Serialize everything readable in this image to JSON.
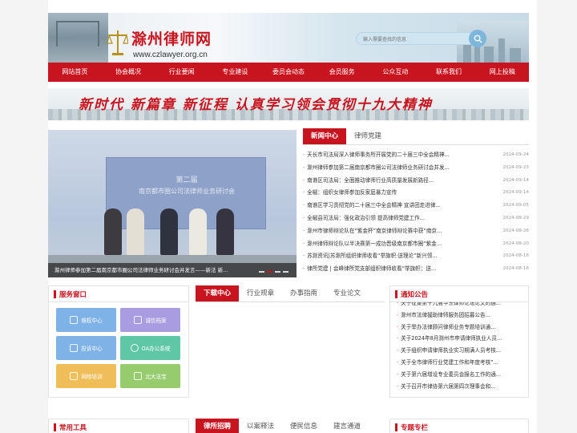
{
  "site": {
    "title": "滁州律师网",
    "url": "www.czlawyer.org.cn"
  },
  "search": {
    "placeholder": "输入需要查找的信息",
    "icon": "search-icon"
  },
  "nav": [
    {
      "label": "网站首页"
    },
    {
      "label": "协会概况"
    },
    {
      "label": "行业要闻"
    },
    {
      "label": "专业建设"
    },
    {
      "label": "委员会动态"
    },
    {
      "label": "会员服务"
    },
    {
      "label": "公众互动"
    },
    {
      "label": "联系我们"
    },
    {
      "label": "网上投稿"
    }
  ],
  "banner": {
    "text": "新时代 新篇章 新征程 认真学习领会贯彻十九大精神"
  },
  "slideshow": {
    "caption": "滁州律师参加第二届南京都市圈公司法律师业务研讨会并发言——新法 新...",
    "board_text": "第二届",
    "board_text2": "南京都市圈公司法律师业务研讨会",
    "active_dot": 1
  },
  "news": {
    "tabs": [
      {
        "label": "新闻中心"
      },
      {
        "label": "律师党建"
      }
    ],
    "items": [
      {
        "title": "天长市司法局深入律师事务所开展党的二十届三中全会精神...",
        "date": "2024-09-24"
      },
      {
        "title": "滁州律师参加第二届南京都市圈公司法律师业务研讨会并发...",
        "date": "2024-09-23"
      },
      {
        "title": "南谯区司法局：全面推动律师行业高质量发展新路径...",
        "date": "2024-09-14"
      },
      {
        "title": "全椒：组织女律师参加反家庭暴力宣传",
        "date": "2024-09-14"
      },
      {
        "title": "南谯区学习贯彻党的二十届三中全会精神 宣讲团走进律...",
        "date": "2024-09-05"
      },
      {
        "title": "全椒县司法局：强化政治引领 提高律师党建工作...",
        "date": "2024-08-29"
      },
      {
        "title": "滁州市律师辩论队在“紫金杯”南京律师辩论赛中获“南京...",
        "date": "2024-08-26"
      },
      {
        "title": "滁州律师辩论队以半决赛第一成功晋级南京都市圈“紫金...",
        "date": "2024-08-20"
      },
      {
        "title": "苏滁资讯|苏滁所组织律师收看“举旗帜·送理论”新兴领...",
        "date": "2024-08-16"
      },
      {
        "title": "律所党建 | 会峰律所党支部组织律师收看“举旗帜：送...",
        "date": "2024-08-16"
      }
    ]
  },
  "service": {
    "title": "服务窗口",
    "items": [
      {
        "label": "维权中心",
        "icon": "shield-icon",
        "color": "#7fb2e6"
      },
      {
        "label": "诚信档案",
        "icon": "file-icon",
        "color": "#a99ce0"
      },
      {
        "label": "投诉中心",
        "icon": "message-icon",
        "color": "#7fb2e6"
      },
      {
        "label": "OA办公系统",
        "icon": "gear-icon",
        "color": "#5fc7a6"
      },
      {
        "label": "网络培训",
        "icon": "monitor-icon",
        "color": "#f0be58"
      },
      {
        "label": "北大法宝",
        "icon": "book-icon",
        "color": "#96cc6e"
      }
    ]
  },
  "downloads": {
    "tabs": [
      {
        "label": "下载中心"
      },
      {
        "label": "行业规章"
      },
      {
        "label": "办事指南"
      },
      {
        "label": "专业论文"
      }
    ]
  },
  "notice": {
    "title": "通知公告",
    "items": [
      {
        "title": "关于征集第十九届华东律师论坛论文的通..."
      },
      {
        "title": "滁州市法律援助律师服务团招募公告..."
      },
      {
        "title": "关于举办法律顾问律师业务专题培训通..."
      },
      {
        "title": "关于2024年8月滁州市申请律师执业人员..."
      },
      {
        "title": "关于组织申请律师执业实习期满人员考核..."
      },
      {
        "title": "关于全市律师行业党建工作和年度考核”..."
      },
      {
        "title": "关于第六届增设专业委员会报名工作的通..."
      },
      {
        "title": "关于召开市律协第六届第四次理事会和..."
      }
    ]
  },
  "bottom": {
    "tools_title": "常用工具",
    "tabs": [
      {
        "label": "律所招聘"
      },
      {
        "label": "以案释法"
      },
      {
        "label": "便民信息"
      },
      {
        "label": "建言通道"
      }
    ],
    "topics_title": "专题专栏"
  },
  "colors": {
    "brand_red": "#c8141e"
  }
}
